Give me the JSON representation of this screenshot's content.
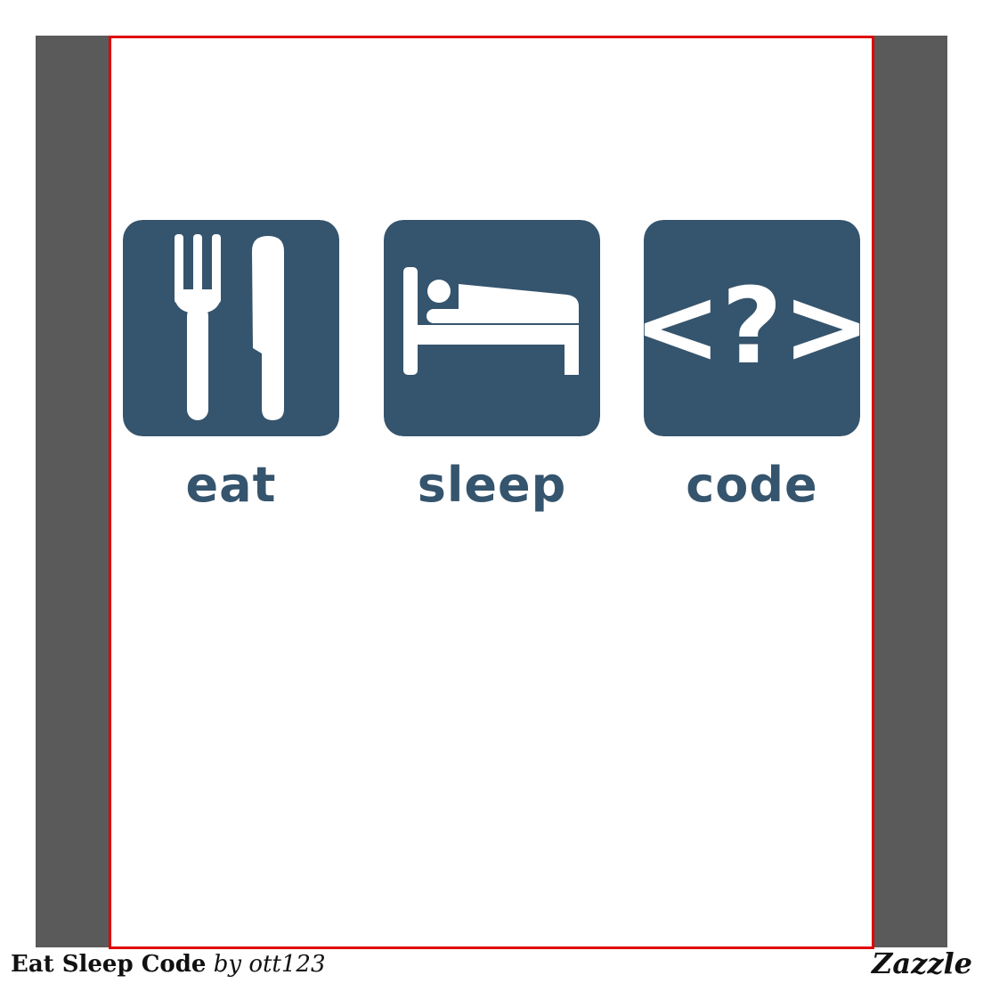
{
  "colors": {
    "tile": "#35546d",
    "tile_glyph": "#ffffff",
    "label": "#35546d",
    "frame": "#5a5a5a",
    "outline": "#e00000"
  },
  "design": {
    "tiles": [
      {
        "icon": "fork-knife-icon",
        "label": "eat"
      },
      {
        "icon": "bed-icon",
        "label": "sleep"
      },
      {
        "icon": "code-tag-icon",
        "label": "code",
        "glyph_text": "<?>"
      }
    ]
  },
  "footer": {
    "product_name": "Eat Sleep Code",
    "byline": "by ott123",
    "brand": "Zazzle"
  }
}
